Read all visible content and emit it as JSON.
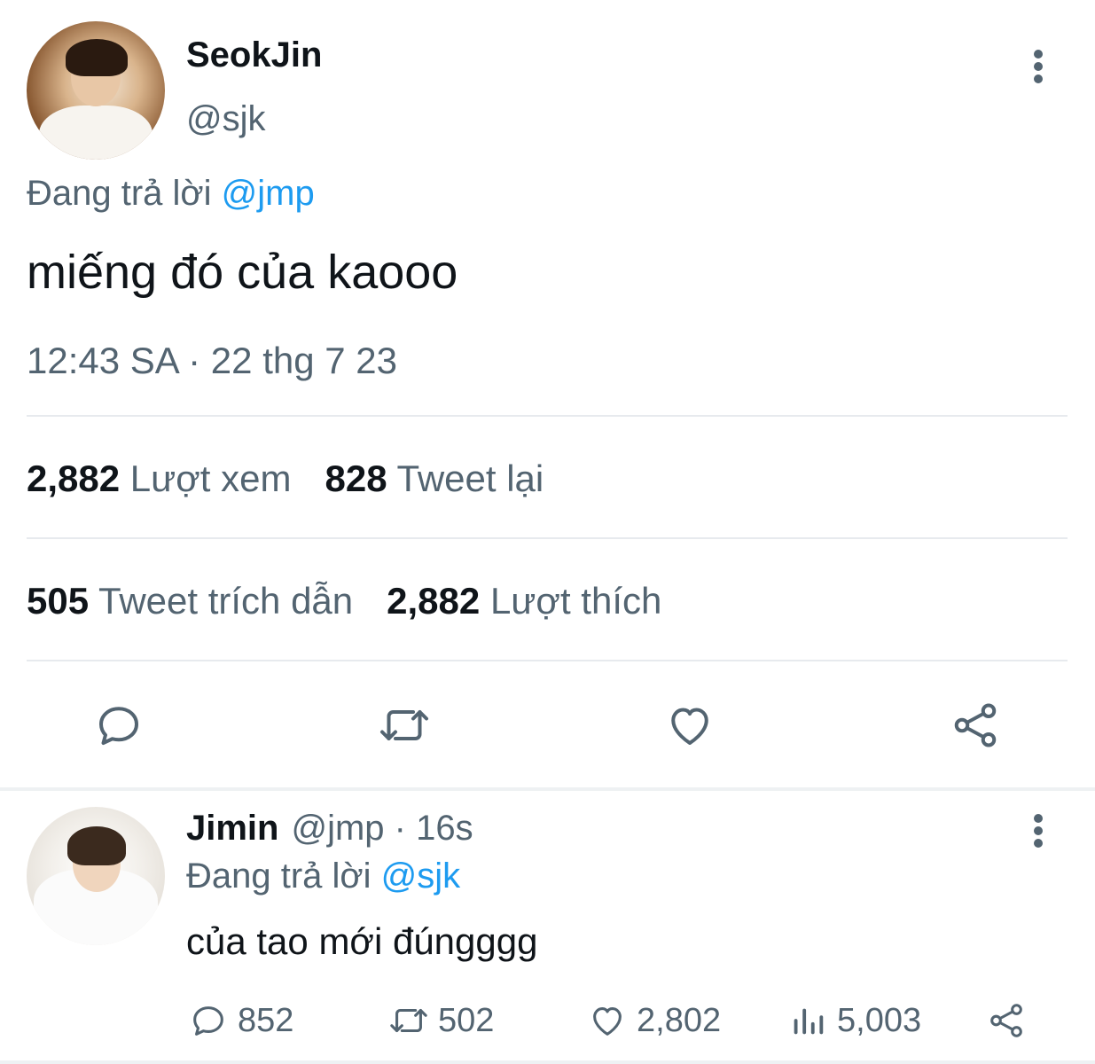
{
  "main_tweet": {
    "display_name": "SeokJin",
    "handle": "@sjk",
    "reply_prefix": "Đang trả lời",
    "reply_mention": "@jmp",
    "text": "miếng đó của kaooo",
    "timestamp": "12:43 SA · 22 thg 7 23",
    "stats": {
      "views_count": "2,882",
      "views_label": "Lượt xem",
      "retweets_count": "828",
      "retweets_label": "Tweet lại",
      "quotes_count": "505",
      "quotes_label": "Tweet trích dẫn",
      "likes_count": "2,882",
      "likes_label": "Lượt thích"
    },
    "actions": [
      "reply-icon",
      "retweet-icon",
      "like-icon",
      "share-icon"
    ]
  },
  "reply_tweet": {
    "display_name": "Jimin",
    "meta": "@jmp · 16s",
    "reply_prefix": "Đang trả lời",
    "reply_mention": "@sjk",
    "text": "của tao mới đúngggg",
    "counts": {
      "replies": "852",
      "retweets": "502",
      "likes": "2,802",
      "views": "5,003"
    }
  },
  "colors": {
    "text_primary": "#0f1419",
    "text_secondary": "#536471",
    "accent": "#1d9bf0",
    "divider": "#e7eaee"
  }
}
